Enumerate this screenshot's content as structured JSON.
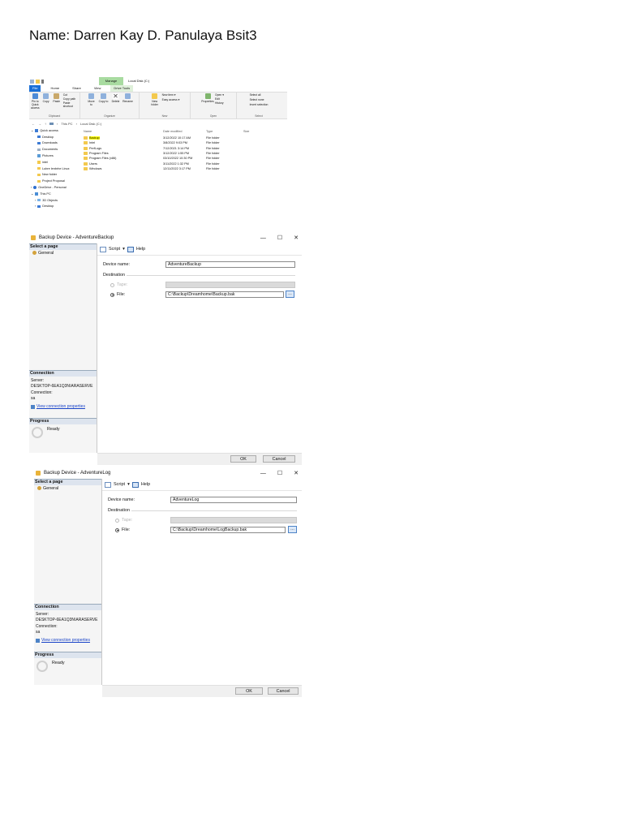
{
  "page": {
    "heading": "Name: Darren Kay D. Panulaya Bsit3"
  },
  "explorer": {
    "manage_tab": "Manage",
    "window_title": "Local Disk (C:)",
    "tabs": [
      "File",
      "Home",
      "Share",
      "View",
      "Drive Tools"
    ],
    "ribbon_groups": [
      {
        "name": "Clipboard",
        "items": [
          "Pin to Quick access",
          "Copy",
          "Paste"
        ]
      },
      {
        "name": "Organize",
        "items": [
          "Move to",
          "Copy to",
          "Delete",
          "Rename"
        ]
      },
      {
        "name": "New",
        "items": [
          "New folder"
        ]
      },
      {
        "name": "Open",
        "items": [
          "Properties"
        ]
      },
      {
        "name": "Select",
        "items": [
          "Select all",
          "Select none",
          "Invert selection"
        ]
      }
    ],
    "clip_small": [
      "Cut",
      "Copy path",
      "Paste shortcut"
    ],
    "new_small": [
      "New item ▾",
      "Easy access ▾"
    ],
    "open_small": [
      "Open ▾",
      "Edit",
      "History"
    ],
    "address": [
      "This PC",
      "Local Disk (C:)"
    ],
    "columns": [
      "Name",
      "Date modified",
      "Type",
      "Size"
    ],
    "nav": [
      "Quick access",
      "Desktop",
      "Downloads",
      "Documents",
      "Pictures",
      "intel",
      "Lubre lenbrhe Linux",
      "New folder",
      "Project Proposal",
      "OneDrive - Personal",
      "This PC",
      "3D Objects",
      "Desktop"
    ],
    "files": [
      {
        "name": "Backup",
        "date": "3/12/2022 10:17 AM",
        "type": "File folder"
      },
      {
        "name": "Intel",
        "date": "3/8/2022 9:03 PM",
        "type": "File folder"
      },
      {
        "name": "PerfLogs",
        "date": "7/12/2021 3:14 PM",
        "type": "File folder"
      },
      {
        "name": "Program Files",
        "date": "3/12/2022 1:55 PM",
        "type": "File folder"
      },
      {
        "name": "Program Files (x86)",
        "date": "03/10/2022 10:30 PM",
        "type": "File folder"
      },
      {
        "name": "Users",
        "date": "3/11/2022 1:32 PM",
        "type": "File folder"
      },
      {
        "name": "Windows",
        "date": "12/11/2022 3:17 PM",
        "type": "File folder"
      }
    ]
  },
  "dialog1": {
    "title": "Backup Device - AdventureBackup",
    "select_page": "Select a page",
    "general": "General",
    "script": "Script",
    "help": "Help",
    "device_label": "Device name:",
    "device_value": "AdventureBackup",
    "destination": "Destination",
    "tape": "Tape:",
    "file": "File:",
    "file_value": "C:\\Backup\\Dreamhome\\Backup.bak",
    "connection": "Connection",
    "server_label": "Server:",
    "server_value": "DESKTOP-6EA1Q3N\\ARASERVE",
    "conn_label": "Connection:",
    "conn_value": "sa",
    "view_props": "View connection properties",
    "progress": "Progress",
    "ready": "Ready",
    "ok": "OK",
    "cancel": "Cancel",
    "minimize": "—",
    "maximize": "☐",
    "close": "✕"
  },
  "dialog2": {
    "title": "Backup Device - AdventureLog",
    "select_page": "Select a page",
    "general": "General",
    "script": "Script",
    "help": "Help",
    "device_label": "Device name:",
    "device_value": "AdventureLog",
    "destination": "Destination",
    "tape": "Tape:",
    "file": "File:",
    "file_value": "C:\\Backup\\Dreamhome\\LogBackup.bak",
    "connection": "Connection",
    "server_label": "Server:",
    "server_value": "DESKTOP-6EA1Q3N\\ARASERVE",
    "conn_label": "Connection:",
    "conn_value": "sa",
    "view_props": "View connection properties",
    "progress": "Progress",
    "ready": "Ready",
    "ok": "OK",
    "cancel": "Cancel",
    "minimize": "—",
    "maximize": "☐",
    "close": "✕"
  }
}
